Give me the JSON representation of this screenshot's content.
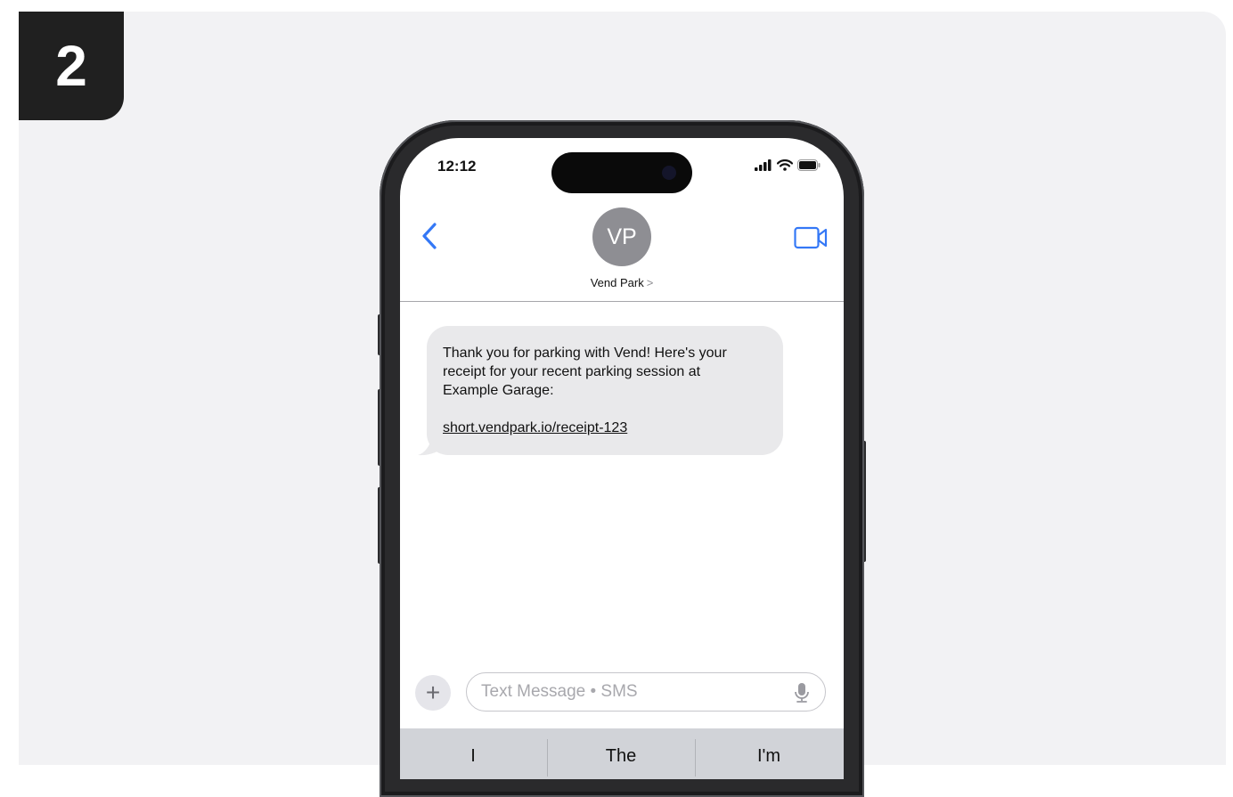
{
  "step": {
    "number": "2"
  },
  "status_bar": {
    "time": "12:12"
  },
  "conversation": {
    "avatar_initials": "VP",
    "contact_name": "Vend Park",
    "chevron": ">"
  },
  "message": {
    "lines": [
      "Thank you for parking with Vend! Here's your",
      "receipt for your recent parking session at",
      "Example Garage:"
    ],
    "link": "short.vendpark.io/receipt-123"
  },
  "composer": {
    "plus": "+",
    "placeholder": "Text Message • SMS"
  },
  "keyboard": {
    "suggestions": [
      "I",
      "The",
      "I'm"
    ]
  },
  "colors": {
    "accent": "#3478f6",
    "bubble": "#e9e9eb",
    "badge": "#202020"
  },
  "icons": [
    "back-chevron-icon",
    "video-call-icon",
    "signal-icon",
    "wifi-icon",
    "battery-icon",
    "microphone-icon"
  ]
}
